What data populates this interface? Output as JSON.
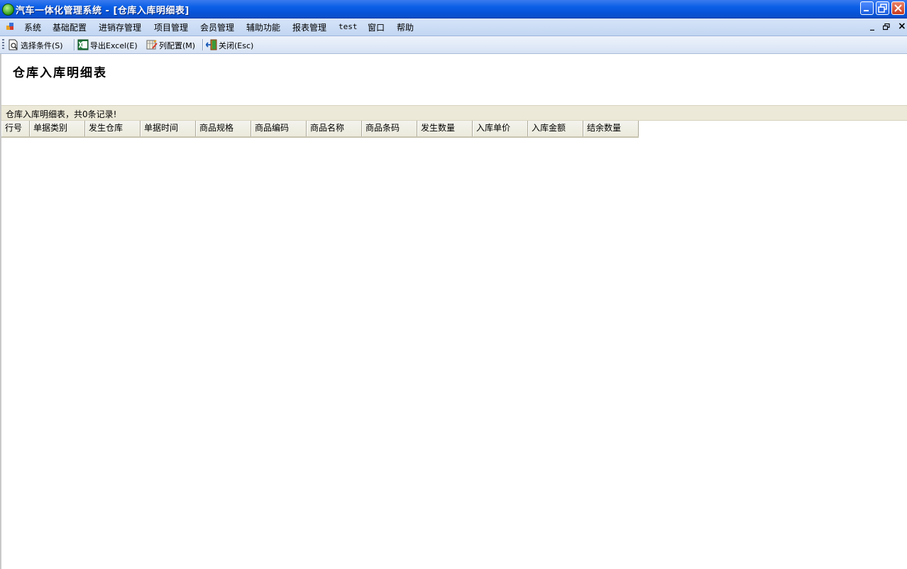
{
  "window": {
    "title": "汽车一体化管理系统 - [仓库入库明细表]"
  },
  "menu": {
    "items": [
      "系统",
      "基础配置",
      "进销存管理",
      "项目管理",
      "会员管理",
      "辅助功能",
      "报表管理",
      "test",
      "窗口",
      "帮助"
    ],
    "mdi_controls": [
      "_",
      "🗗",
      "×"
    ]
  },
  "toolbar": {
    "select_condition": "选择条件(S)",
    "export_excel": "导出Excel(E)",
    "column_config": "列配置(M)",
    "close": "关闭(Esc)"
  },
  "report": {
    "title": "仓库入库明细表",
    "record_summary": "仓库入库明细表，共0条记录!"
  },
  "grid": {
    "columns": [
      "行号",
      "单据类别",
      "发生仓库",
      "单据时间",
      "商品规格",
      "商品编码",
      "商品名称",
      "商品条码",
      "发生数量",
      "入库单价",
      "入库金额",
      "结余数量"
    ],
    "rows": []
  },
  "colors": {
    "title_bar": "#0a5fe6",
    "menu_bar": "#c2d6f2",
    "grid_header": "#ece9d8",
    "close_button": "#c83a1c"
  }
}
